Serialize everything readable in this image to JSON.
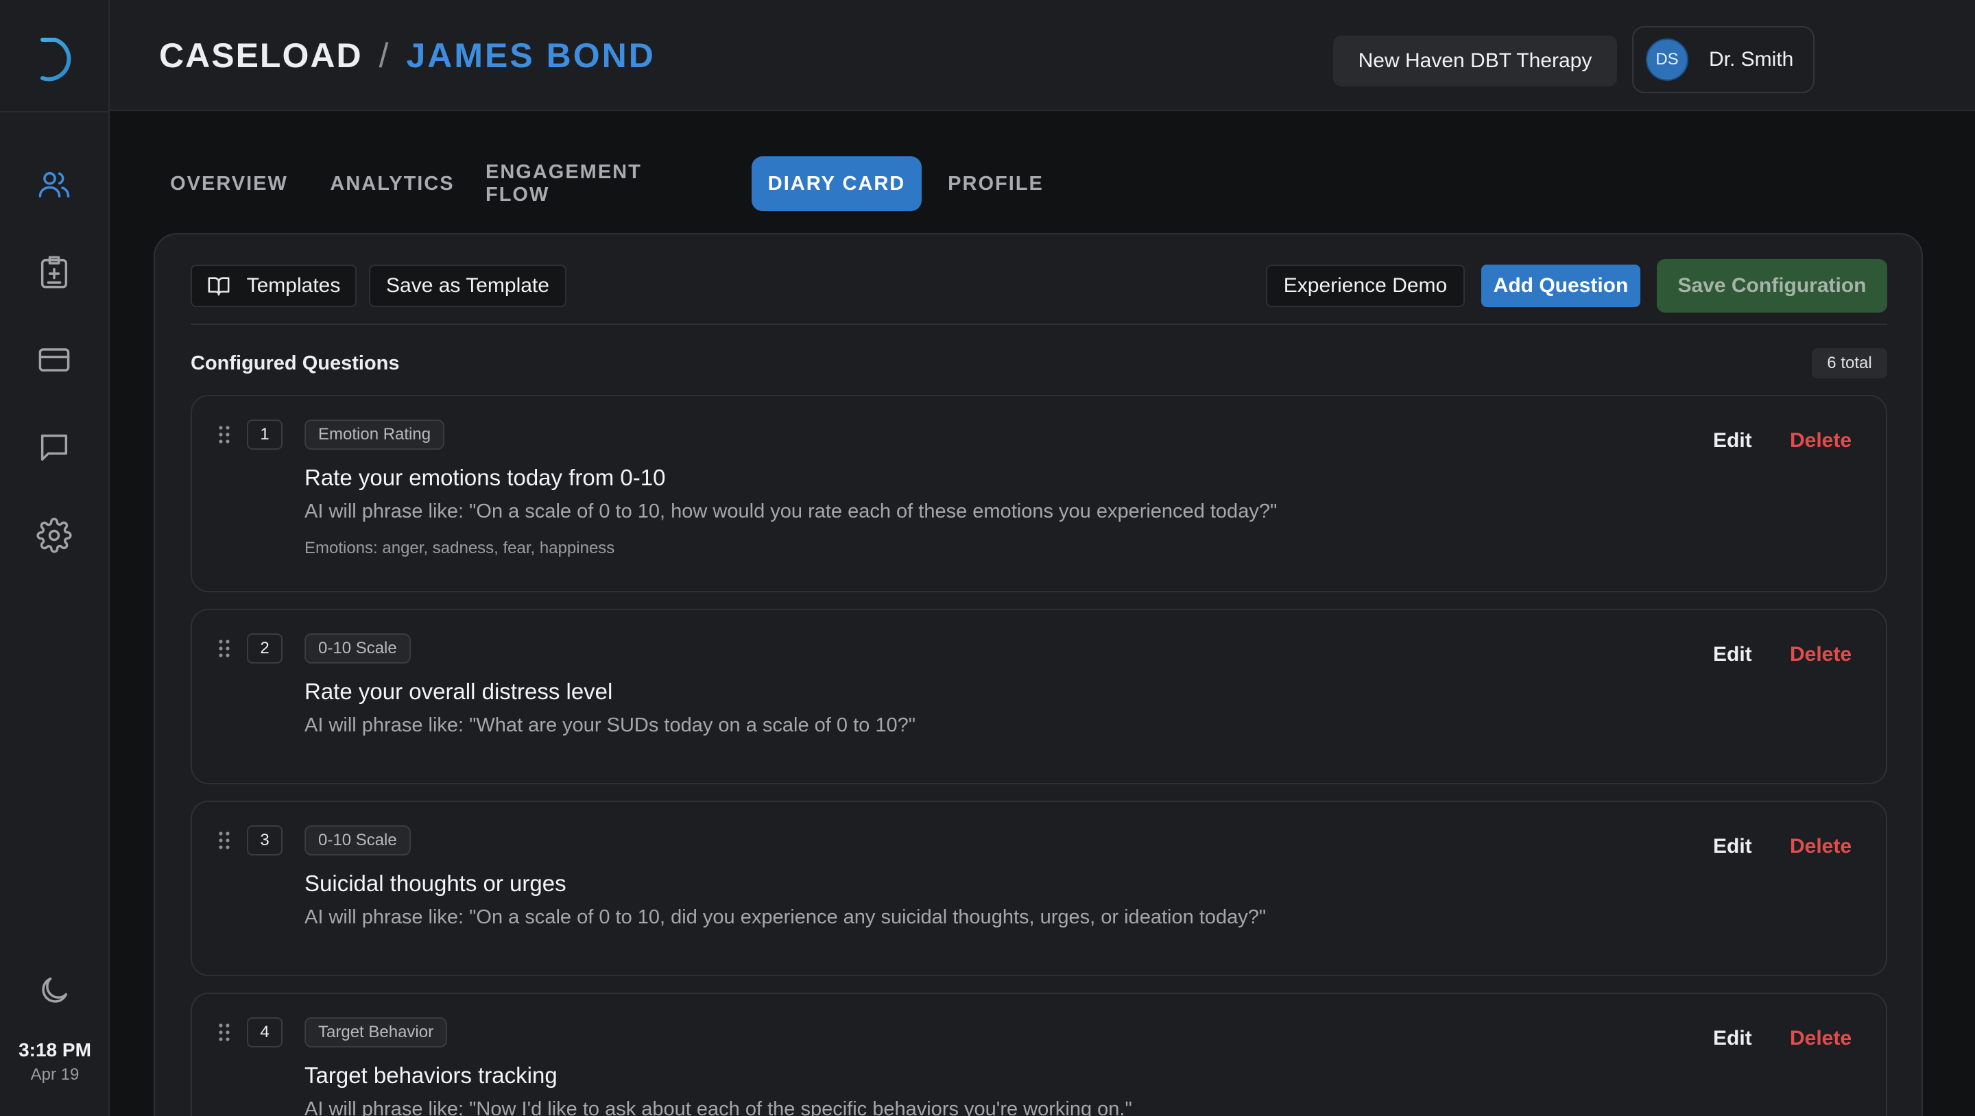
{
  "sidebar": {
    "clock": {
      "time": "3:18 PM",
      "date": "Apr 19"
    }
  },
  "header": {
    "breadcrumb_root": "CASELOAD",
    "breadcrumb_sep": "/",
    "breadcrumb_current": "JAMES BOND",
    "organization": "New Haven DBT Therapy",
    "user_initials": "DS",
    "user_name": "Dr. Smith"
  },
  "tabs": [
    {
      "label": "OVERVIEW"
    },
    {
      "label": "ANALYTICS"
    },
    {
      "label": "ENGAGEMENT FLOW"
    },
    {
      "label": "DIARY CARD",
      "active": true
    },
    {
      "label": "PROFILE"
    }
  ],
  "toolbar": {
    "templates_label": "Templates",
    "save_template_label": "Save as Template",
    "demo_label": "Experience Demo",
    "add_question_label": "Add Question",
    "save_config_label": "Save Configuration"
  },
  "questions_section": {
    "title": "Configured Questions",
    "total": "6 total"
  },
  "questions": [
    {
      "number": "1",
      "type": "Emotion Rating",
      "title": "Rate your emotions today from 0-10",
      "phrase": "AI will phrase like: \"On a scale of 0 to 10, how would you rate each of these emotions you experienced today?\"",
      "extra": "Emotions: anger, sadness, fear, happiness",
      "edit": "Edit",
      "delete": "Delete"
    },
    {
      "number": "2",
      "type": "0-10 Scale",
      "title": "Rate your overall distress level",
      "phrase": "AI will phrase like: \"What are your SUDs today on a scale of 0 to 10?\"",
      "edit": "Edit",
      "delete": "Delete"
    },
    {
      "number": "3",
      "type": "0-10 Scale",
      "title": "Suicidal thoughts or urges",
      "phrase": "AI will phrase like: \"On a scale of 0 to 10, did you experience any suicidal thoughts, urges, or ideation today?\"",
      "edit": "Edit",
      "delete": "Delete"
    },
    {
      "number": "4",
      "type": "Target Behavior",
      "title": "Target behaviors tracking",
      "phrase": "AI will phrase like: \"Now I'd like to ask about each of the specific behaviors you're working on.\"",
      "edit": "Edit",
      "delete": "Delete"
    }
  ],
  "colors": {
    "accent": "#2f78c6",
    "link_blue": "#3d8ee0",
    "danger": "#e24c4c",
    "save_green": "#2f5836"
  }
}
